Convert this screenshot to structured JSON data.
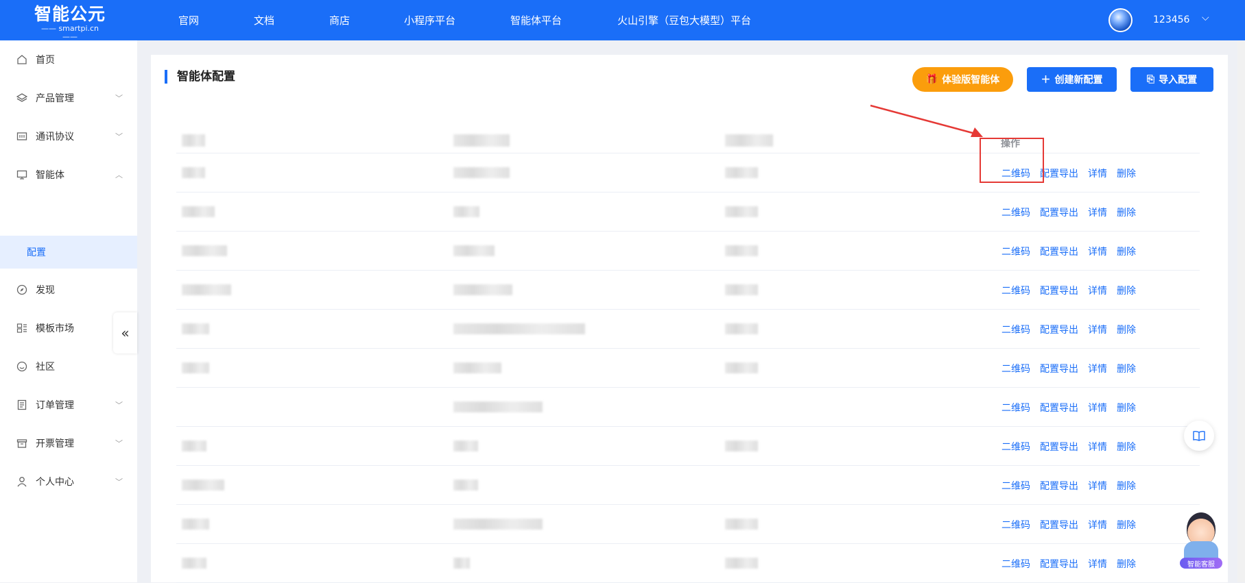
{
  "brand": {
    "name": "智能公元",
    "domain": "smartpi.cn"
  },
  "nav": [
    "官网",
    "文档",
    "商店",
    "小程序平台",
    "智能体平台",
    "火山引擎（豆包大模型）平台"
  ],
  "user": {
    "name": "123456"
  },
  "sidebar": {
    "items": [
      {
        "label": "首页",
        "icon": "home-icon",
        "expandable": false
      },
      {
        "label": "产品管理",
        "icon": "layers-icon",
        "expandable": true
      },
      {
        "label": "通讯协议",
        "icon": "protocol-icon",
        "expandable": true
      },
      {
        "label": "智能体",
        "icon": "monitor-icon",
        "expandable": true,
        "expanded": true
      },
      {
        "label": "发现",
        "icon": "compass-icon",
        "expandable": false
      },
      {
        "label": "模板市场",
        "icon": "template-icon",
        "expandable": false
      },
      {
        "label": "社区",
        "icon": "smile-icon",
        "expandable": false
      },
      {
        "label": "订单管理",
        "icon": "order-icon",
        "expandable": true
      },
      {
        "label": "开票管理",
        "icon": "invoice-icon",
        "expandable": true
      },
      {
        "label": "个人中心",
        "icon": "user-icon",
        "expandable": true
      }
    ],
    "active_sub": "配置"
  },
  "page": {
    "title": "智能体配置",
    "buttons": {
      "experience": "体验版智能体",
      "create": "创建新配置",
      "import": "导入配置"
    }
  },
  "table": {
    "op_header": "操作",
    "row_count": 11,
    "actions": [
      "二维码",
      "配置导出",
      "详情",
      "删除"
    ]
  },
  "assistant": {
    "label": "智能客服"
  },
  "colors": {
    "primary": "#1a6ef8",
    "orange": "#fb9d0c",
    "annotation": "#e53935"
  }
}
